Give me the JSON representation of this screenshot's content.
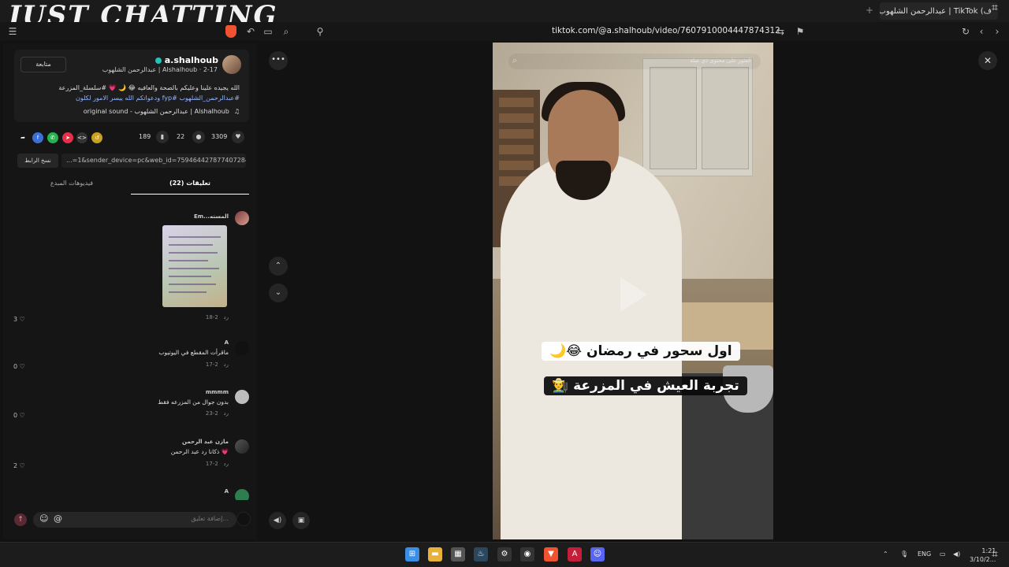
{
  "stream_overlay": {
    "logo_text": "JUST CHATTING"
  },
  "browser": {
    "tab_title": "عبدالرحمن الشلهوب | TikTok (ف",
    "url": "tiktok.com/@a.shalhoub/video/7607910004447874312"
  },
  "post": {
    "username": "a.shalhoub",
    "subline": "عبدالرحمن الشلهوب | Alshalhoub · 2-17",
    "follow_label": "متابعة",
    "caption_line1": "الله يجيده علينا وعليكم بالصحة والعافيه 😂 🌙 💗 #سلسلة_المزرعة",
    "caption_line2": "#عبدالرحمن_الشلهوب #fyp ودعواتكم الله ييسر الامور لكلون",
    "music": "original sound - عبدالرحمن الشلهوب | Alshalhoub",
    "likes": "3309",
    "comments_count": "22",
    "bookmarks": "189",
    "link": "...=1&sender_device=pc&web_id=7594644278774072844",
    "copy_link_label": "نسخ الرابط"
  },
  "tabs": [
    {
      "label": "(22) تعليقات"
    },
    {
      "label": "فيديوهات المبدع"
    }
  ],
  "comments": [
    {
      "name": "Em...المسته",
      "text": "",
      "date": "2-18",
      "reply": "رد",
      "likes": "3"
    },
    {
      "name": "A",
      "text": "ماقرأت المقطع في اليوتيوب",
      "date": "2-17",
      "reply": "رد",
      "likes": "0"
    },
    {
      "name": "mmmm",
      "text": "بدون جوال من المزرعه فقط",
      "date": "2-23",
      "reply": "رد",
      "likes": "0"
    },
    {
      "name": "مازن عبد الرحمن",
      "text": "💗 ذكانا رد عبد الرحمن",
      "date": "2-17",
      "reply": "رد",
      "likes": "2"
    },
    {
      "name": "A",
      "text": "...",
      "date": "",
      "reply": "",
      "likes": ""
    }
  ],
  "comment_input": {
    "placeholder": "إضافة تعليق..."
  },
  "video": {
    "search_placeholder": "العثور على محتوى ذي صلة",
    "caption1": "اول سحور في رمضان 😂🌙",
    "caption2": "تجربة العيش في المزرعة 👨‍🌾"
  },
  "taskbar": {
    "lang": "ENG",
    "time": "1:21",
    "date": "3/10/2..."
  },
  "colors": {
    "accent": "#fe2c55",
    "verified": "#20c3b5",
    "hashtag": "#8fb3ff"
  }
}
